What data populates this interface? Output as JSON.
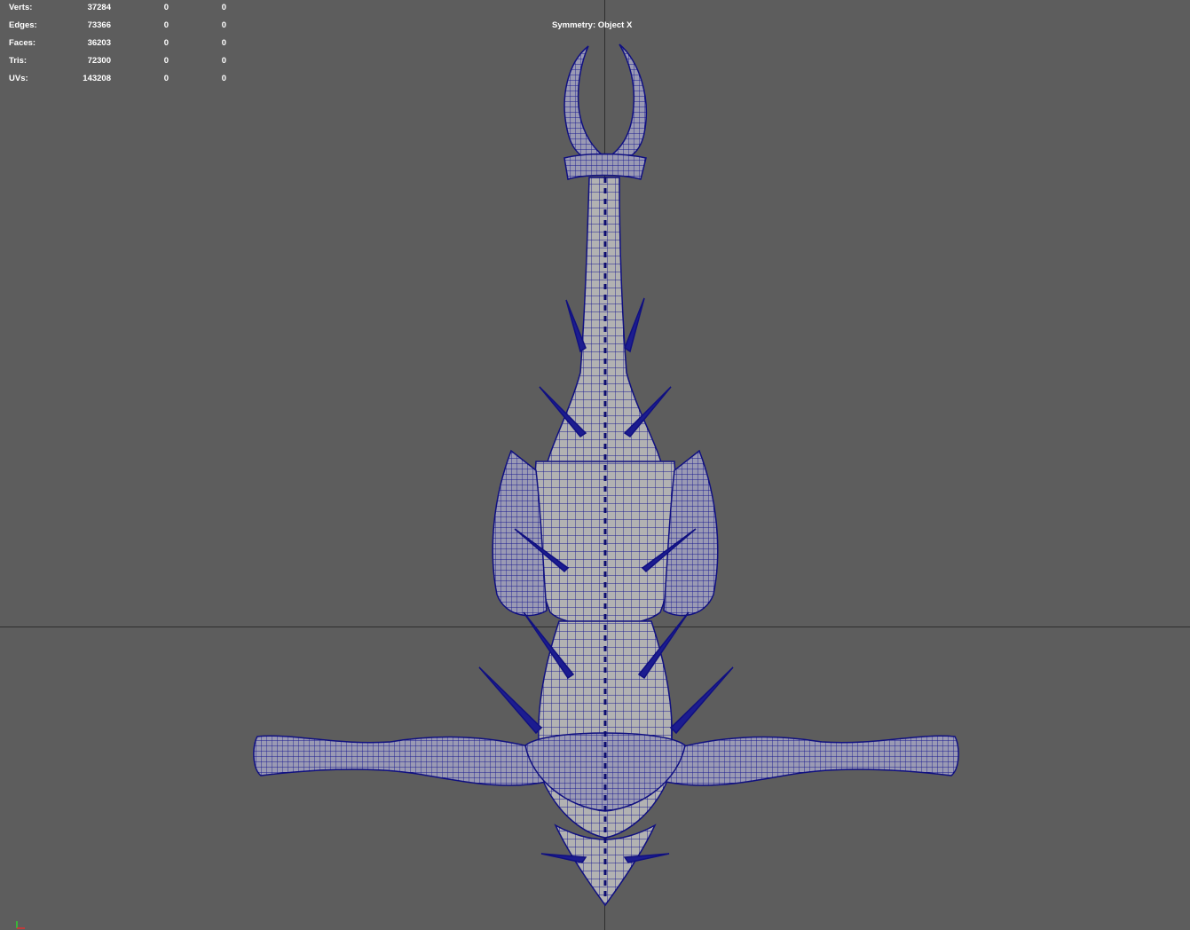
{
  "viewport": {
    "background": "#5d5d5d",
    "wire_color": "#1a1a8c",
    "surface_color": "#b4b4b4"
  },
  "hud": {
    "rows": [
      {
        "label": "Verts:",
        "total": "37284",
        "selected": "0",
        "extra": "0"
      },
      {
        "label": "Edges:",
        "total": "73366",
        "selected": "0",
        "extra": "0"
      },
      {
        "label": "Faces:",
        "total": "36203",
        "selected": "0",
        "extra": "0"
      },
      {
        "label": "Tris:",
        "total": "72300",
        "selected": "0",
        "extra": "0"
      },
      {
        "label": "UVs:",
        "total": "143208",
        "selected": "0",
        "extra": "0"
      }
    ]
  },
  "symmetry": {
    "label": "Symmetry: Object X"
  },
  "model": {
    "icon": "wireframe-creature-mesh"
  },
  "axis_gizmo": {
    "icon": "axis-gizmo-icon"
  }
}
